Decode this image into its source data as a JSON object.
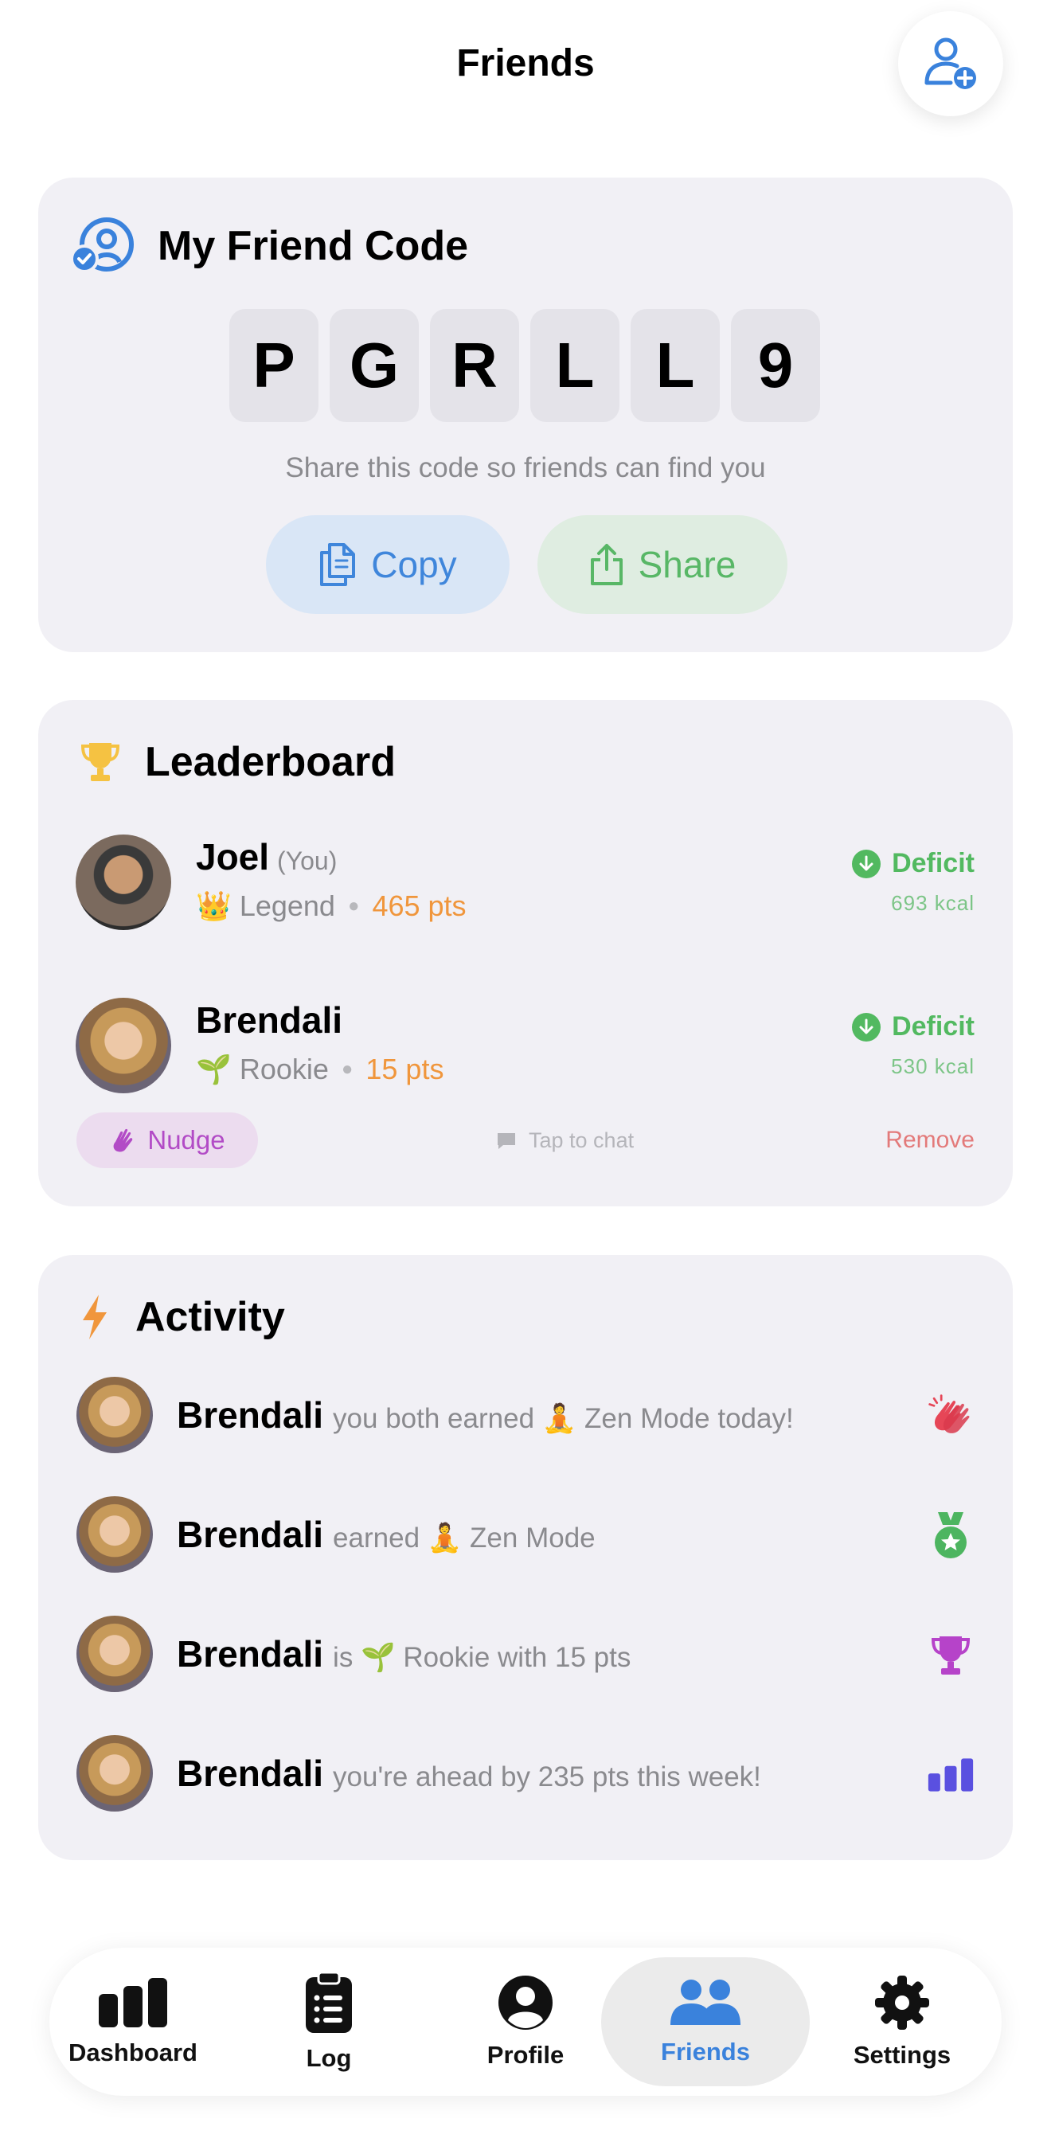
{
  "header": {
    "title": "Friends",
    "add_friend_icon": "person-add-icon"
  },
  "friend_code": {
    "title": "My Friend Code",
    "chars": [
      "P",
      "G",
      "R",
      "L",
      "L",
      "9"
    ],
    "hint": "Share this code so friends can find you",
    "copy_label": "Copy",
    "share_label": "Share"
  },
  "leaderboard": {
    "title": "Leaderboard",
    "entries": [
      {
        "name": "Joel",
        "you_tag": "(You)",
        "badge_emoji": "👑",
        "rank": "Legend",
        "points": "465 pts",
        "status": "Deficit",
        "kcal": "693 kcal"
      },
      {
        "name": "Brendali",
        "badge_emoji": "🌱",
        "rank": "Rookie",
        "points": "15 pts",
        "status": "Deficit",
        "kcal": "530 kcal"
      }
    ],
    "nudge_label": "Nudge",
    "tap_to_chat": "Tap to chat",
    "remove_label": "Remove"
  },
  "activity": {
    "title": "Activity",
    "items": [
      {
        "name": "Brendali",
        "text": "you both earned 🧘 Zen Mode today!",
        "icon": "clapping-hands-icon"
      },
      {
        "name": "Brendali",
        "text": "earned 🧘 Zen Mode",
        "icon": "medal-icon"
      },
      {
        "name": "Brendali",
        "text": "is 🌱 Rookie with 15 pts",
        "icon": "trophy-icon"
      },
      {
        "name": "Brendali",
        "text": "you're ahead by 235 pts this week!",
        "icon": "bar-chart-icon"
      }
    ]
  },
  "tabs": [
    {
      "label": "Dashboard",
      "icon": "chart-bars-icon"
    },
    {
      "label": "Log",
      "icon": "clipboard-list-icon"
    },
    {
      "label": "Profile",
      "icon": "profile-circle-icon"
    },
    {
      "label": "Friends",
      "icon": "people-icon",
      "active": true
    },
    {
      "label": "Settings",
      "icon": "gear-icon"
    }
  ],
  "colors": {
    "accent_blue": "#3a82dc",
    "success_green": "#52b960",
    "points_orange": "#f0963c",
    "nudge_purple": "#b24bc6",
    "remove_red": "#e37a7a",
    "card_bg": "#f1f0f5"
  }
}
